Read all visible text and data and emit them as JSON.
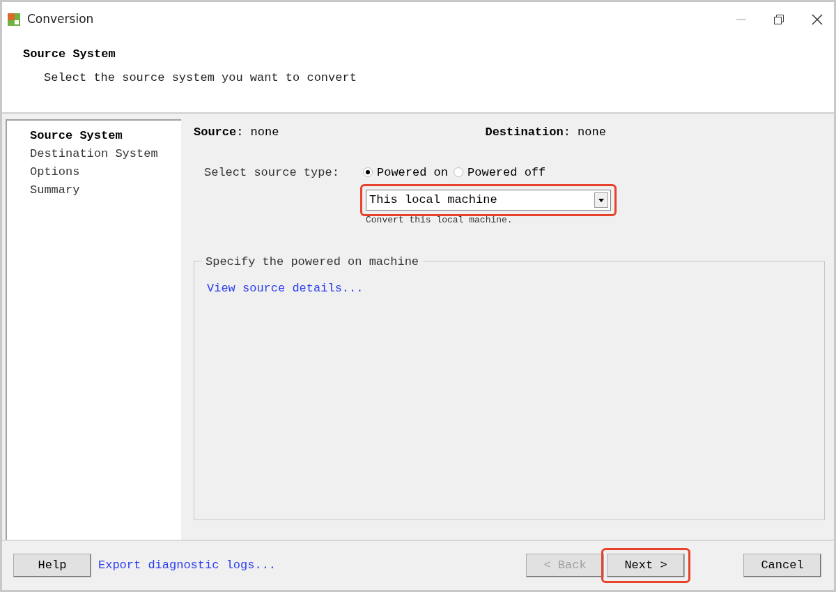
{
  "window": {
    "title": "Conversion"
  },
  "header": {
    "title": "Source System",
    "subtitle": "Select the source system you want to convert"
  },
  "steps": [
    {
      "label": "Source System",
      "selected": true
    },
    {
      "label": "Destination System",
      "selected": false
    },
    {
      "label": "Options",
      "selected": false
    },
    {
      "label": "Summary",
      "selected": false
    }
  ],
  "summary": {
    "source": "**Source**: none",
    "destination": "**Destination**: none"
  },
  "source_type": {
    "label": "Select source type:",
    "options": [
      {
        "label": "Powered on",
        "selected": true
      },
      {
        "label": "Powered off",
        "selected": false
      }
    ]
  },
  "machine_select": {
    "value": "This local machine",
    "highlighted": true,
    "hint": "Convert this local machine."
  },
  "group": {
    "title": "Specify the powered on machine",
    "link": "View source details..."
  },
  "footer": {
    "help": "Help",
    "export_link": "Export diagnostic logs...",
    "back": {
      "label": "< Back",
      "disabled": true
    },
    "next": {
      "label": "Next >",
      "highlighted": true
    },
    "cancel": "Cancel"
  }
}
